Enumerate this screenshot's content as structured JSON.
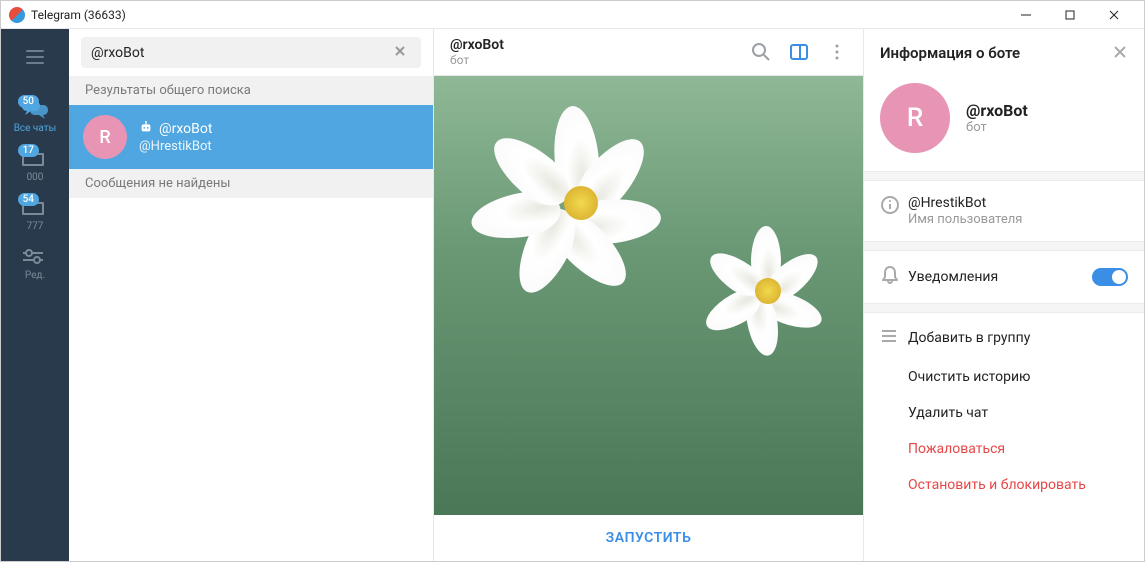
{
  "window": {
    "title": "Telegram (36633)"
  },
  "rail": {
    "items": [
      {
        "label": "Все чаты",
        "badge": "50"
      },
      {
        "label": "000",
        "badge": "17"
      },
      {
        "label": "777",
        "badge": "54"
      },
      {
        "label": "Ред."
      }
    ]
  },
  "search": {
    "value": "@rxoBot"
  },
  "results": {
    "header": "Результаты общего поиска",
    "item": {
      "title": "@rxoBot",
      "sub": "@HrestikBot",
      "initial": "R"
    },
    "no_msgs": "Сообщения не найдены"
  },
  "chat": {
    "title": "@rxoBot",
    "sub": "бот",
    "start": "ЗАПУСТИТЬ"
  },
  "info": {
    "header": "Информация о боте",
    "name": "@rxoBot",
    "type": "бот",
    "initial": "R",
    "username": "@HrestikBot",
    "username_label": "Имя пользователя",
    "notifications": "Уведомления",
    "actions": {
      "add_group": "Добавить в группу",
      "clear": "Очистить историю",
      "delete": "Удалить чат",
      "report": "Пожаловаться",
      "stop": "Остановить и блокировать"
    }
  }
}
